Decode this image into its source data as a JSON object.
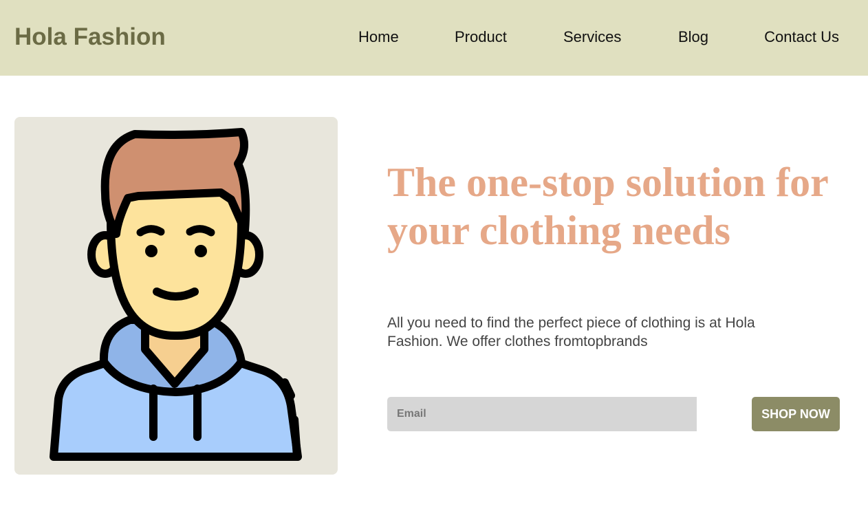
{
  "navbar": {
    "brand": "Hola Fashion",
    "links": [
      "Home",
      "Product",
      "Services",
      "Blog",
      "Contact Us"
    ]
  },
  "hero": {
    "illustration": "avatar-illustration",
    "headline": "The one-stop solution for your clothing needs",
    "subtext": "All you need to find the perfect piece of clothing is at Hola Fashion. We offer clothes fromtopbrands",
    "email_placeholder": "Email",
    "button_label": "SHOP NOW"
  },
  "colors": {
    "navbar_bg": "#e0e0c0",
    "brand_text": "#6b6b45",
    "headline": "#e6a888",
    "button_bg": "#8c8c66",
    "card_bg": "#e8e6dc",
    "input_bg": "#d6d6d6"
  }
}
